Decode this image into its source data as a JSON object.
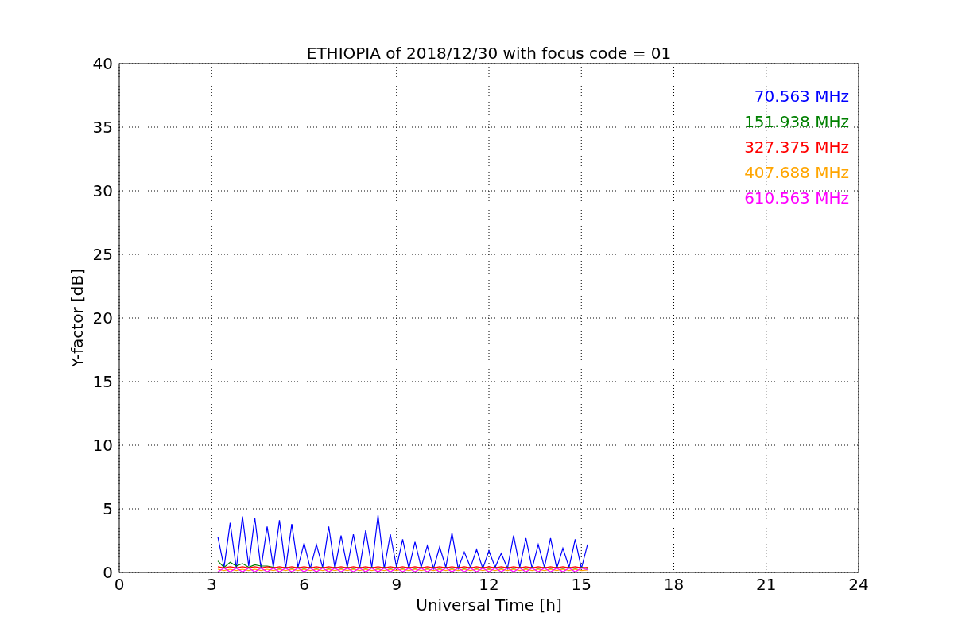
{
  "chart_data": {
    "type": "line",
    "title": "ETHIOPIA of 2018/12/30 with focus code = 01",
    "xlabel": "Universal Time [h]",
    "ylabel": "Y-factor [dB]",
    "xlim": [
      0,
      24
    ],
    "ylim": [
      0,
      40
    ],
    "grid": true,
    "xticks": [
      0,
      3,
      6,
      9,
      12,
      15,
      18,
      21,
      24
    ],
    "yticks": [
      0,
      5,
      10,
      15,
      20,
      25,
      30,
      35,
      40
    ],
    "x": [
      3.2,
      3.4,
      3.6,
      3.8,
      4.0,
      4.2,
      4.4,
      4.6,
      4.8,
      5.0,
      5.2,
      5.4,
      5.6,
      5.8,
      6.0,
      6.2,
      6.4,
      6.6,
      6.8,
      7.0,
      7.2,
      7.4,
      7.6,
      7.8,
      8.0,
      8.2,
      8.4,
      8.6,
      8.8,
      9.0,
      9.2,
      9.4,
      9.6,
      9.8,
      10.0,
      10.2,
      10.4,
      10.6,
      10.8,
      11.0,
      11.2,
      11.4,
      11.6,
      11.8,
      12.0,
      12.2,
      12.4,
      12.6,
      12.8,
      13.0,
      13.2,
      13.4,
      13.6,
      13.8,
      14.0,
      14.2,
      14.4,
      14.6,
      14.8,
      15.0,
      15.2
    ],
    "series": [
      {
        "name": "70.563 MHz",
        "color": "#0000ff",
        "values": [
          2.8,
          0.4,
          3.9,
          0.3,
          4.4,
          0.5,
          4.3,
          0.3,
          3.6,
          0.4,
          4.1,
          0.3,
          3.8,
          0.4,
          2.3,
          0.3,
          2.2,
          0.4,
          3.6,
          0.3,
          2.9,
          0.4,
          3.0,
          0.3,
          3.3,
          0.4,
          4.5,
          0.3,
          3.0,
          0.4,
          2.6,
          0.3,
          2.4,
          0.4,
          2.1,
          0.3,
          2.0,
          0.4,
          3.1,
          0.3,
          1.6,
          0.4,
          1.8,
          0.3,
          1.7,
          0.4,
          1.5,
          0.3,
          2.9,
          0.4,
          2.7,
          0.3,
          2.2,
          0.4,
          2.7,
          0.3,
          1.9,
          0.4,
          2.6,
          0.3,
          2.2
        ]
      },
      {
        "name": "151.938 MHz",
        "color": "#008000",
        "values": [
          0.9,
          0.4,
          0.8,
          0.5,
          0.7,
          0.4,
          0.6,
          0.5,
          0.5,
          0.4,
          0.3,
          0.4,
          0.3,
          0.4,
          0.3,
          0.4,
          0.3,
          0.4,
          0.3,
          0.4,
          0.3,
          0.4,
          0.3,
          0.4,
          0.3,
          0.4,
          0.3,
          0.4,
          0.3,
          0.4,
          0.3,
          0.4,
          0.3,
          0.4,
          0.3,
          0.4,
          0.3,
          0.4,
          0.3,
          0.4,
          0.3,
          0.4,
          0.3,
          0.4,
          0.3,
          0.4,
          0.3,
          0.4,
          0.3,
          0.4,
          0.3,
          0.4,
          0.3,
          0.4,
          0.3,
          0.4,
          0.3,
          0.4,
          0.3,
          0.4,
          0.3
        ]
      },
      {
        "name": "327.375 MHz",
        "color": "#ff0000",
        "values": [
          0.45,
          0.35,
          0.45,
          0.35,
          0.45,
          0.35,
          0.45,
          0.35,
          0.45,
          0.35,
          0.45,
          0.35,
          0.45,
          0.35,
          0.45,
          0.35,
          0.45,
          0.35,
          0.45,
          0.35,
          0.45,
          0.35,
          0.45,
          0.35,
          0.45,
          0.35,
          0.45,
          0.35,
          0.45,
          0.35,
          0.45,
          0.35,
          0.45,
          0.35,
          0.45,
          0.35,
          0.45,
          0.35,
          0.45,
          0.35,
          0.45,
          0.35,
          0.45,
          0.35,
          0.45,
          0.35,
          0.45,
          0.35,
          0.45,
          0.35,
          0.45,
          0.35,
          0.45,
          0.35,
          0.45,
          0.35,
          0.45,
          0.35,
          0.45,
          0.35,
          0.4
        ]
      },
      {
        "name": "407.688 MHz",
        "color": "#ffa500",
        "values": [
          0.25,
          0.15,
          0.25,
          0.15,
          0.25,
          0.15,
          0.25,
          0.15,
          0.25,
          0.15,
          0.25,
          0.15,
          0.25,
          0.15,
          0.25,
          0.15,
          0.25,
          0.15,
          0.25,
          0.15,
          0.25,
          0.15,
          0.25,
          0.15,
          0.25,
          0.15,
          0.25,
          0.15,
          0.25,
          0.15,
          0.25,
          0.15,
          0.25,
          0.15,
          0.25,
          0.15,
          0.25,
          0.15,
          0.25,
          0.15,
          0.25,
          0.15,
          0.25,
          0.15,
          0.25,
          0.15,
          0.25,
          0.15,
          0.25,
          0.15,
          0.25,
          0.15,
          0.25,
          0.15,
          0.25,
          0.15,
          0.25,
          0.15,
          0.25,
          0.15,
          0.2
        ]
      },
      {
        "name": "610.563 MHz",
        "color": "#ff00ff",
        "values": [
          0.05,
          0.35,
          0.05,
          0.35,
          0.05,
          0.35,
          0.05,
          0.35,
          0.05,
          0.35,
          0.05,
          0.35,
          0.05,
          0.35,
          0.05,
          0.35,
          0.05,
          0.35,
          0.05,
          0.35,
          0.05,
          0.35,
          0.05,
          0.35,
          0.05,
          0.35,
          0.05,
          0.35,
          0.05,
          0.35,
          0.05,
          0.35,
          0.05,
          0.35,
          0.05,
          0.35,
          0.05,
          0.35,
          0.05,
          0.35,
          0.05,
          0.35,
          0.05,
          0.35,
          0.05,
          0.35,
          0.05,
          0.35,
          0.05,
          0.35,
          0.05,
          0.35,
          0.05,
          0.35,
          0.05,
          0.35,
          0.05,
          0.35,
          0.05,
          0.35,
          0.2
        ]
      }
    ]
  }
}
